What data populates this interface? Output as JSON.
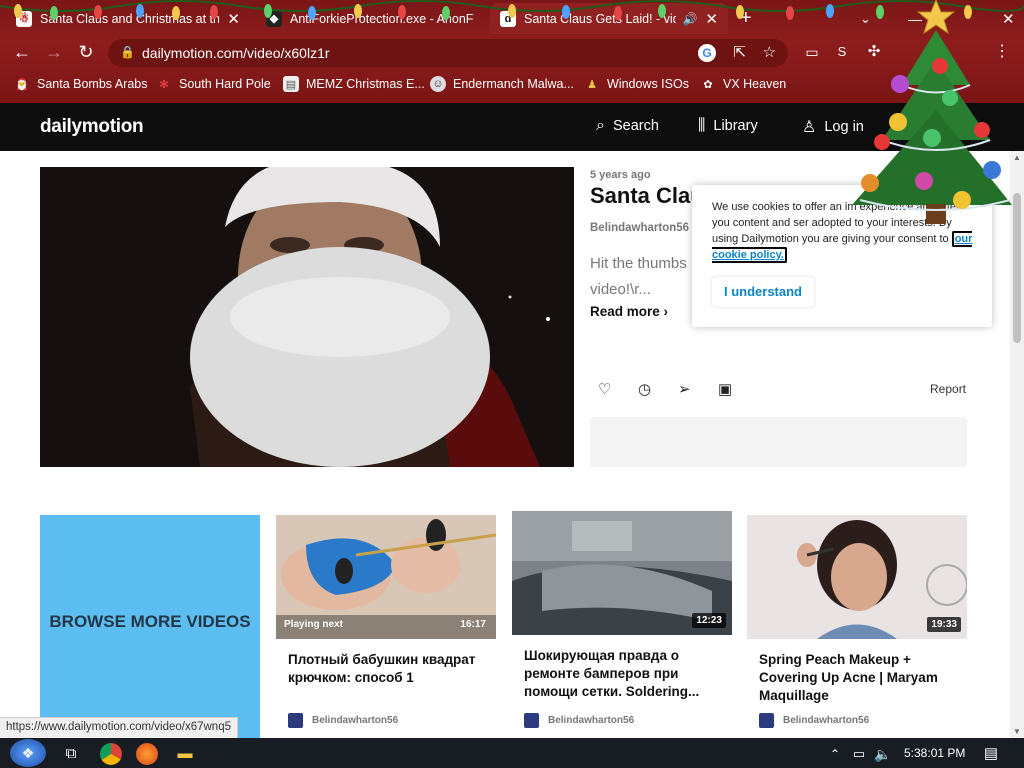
{
  "tabs": [
    {
      "title": "Santa Claus and Christmas at the",
      "fav": "santa-favicon"
    },
    {
      "title": "AntiForkieProtection.exe - AnonF",
      "fav": "anon-favicon"
    },
    {
      "title": "Santa Claus Gets Laid! - vide",
      "fav": "dailymotion-favicon",
      "fav_text": "d"
    }
  ],
  "address": {
    "url": "dailymotion.com/video/x60lz1r"
  },
  "bookmarks": [
    {
      "label": "Santa Bombs Arabs"
    },
    {
      "label": "South Hard Pole"
    },
    {
      "label": "MEMZ Christmas E..."
    },
    {
      "label": "Endermanch Malwa..."
    },
    {
      "label": "Windows ISOs"
    },
    {
      "label": "VX Heaven"
    }
  ],
  "site": {
    "logo": "dailymotion",
    "search": "Search",
    "library": "Library",
    "login": "Log in"
  },
  "video": {
    "ago": "5 years ago",
    "title": "Santa Clau",
    "channel": "Belindawharton56",
    "desc": "Hit the thumbs video!\\r...",
    "read_more": "Read more",
    "report": "Report"
  },
  "cookie": {
    "text": "We use cookies to offer an im experience and offer you content and ser adopted to your interests. By using Dailymotion you are giving your consent to ",
    "link": "our cookie policy.",
    "button": "I understand"
  },
  "browse": "BROWSE MORE VIDEOS",
  "cards": [
    {
      "title": "Плотный бабушкин квадрат крючком: способ 1",
      "duration": "16:17",
      "badge": "Playing next",
      "channel": "Belindawharton56"
    },
    {
      "title": "Шокирующая правда о ремонте бамперов при помощи сетки. Soldering...",
      "duration": "12:23",
      "channel": "Belindawharton56"
    },
    {
      "title": "Spring Peach Makeup + Covering Up Acne | Maryam Maquillage",
      "duration": "19:33",
      "channel": "Belindawharton56"
    }
  ],
  "status_url": "https://www.dailymotion.com/video/x67wnq5",
  "clock": "5:38:01 PM",
  "colors": {
    "chrome": "#8e1d1d",
    "dm_black": "#0d0d0d",
    "accent": "#0a84c6",
    "browse": "#5bbdf0"
  }
}
